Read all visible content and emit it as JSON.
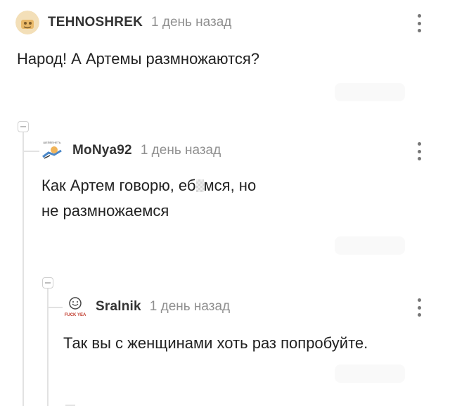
{
  "comments": [
    {
      "username": "TEHNOSHREK",
      "timestamp": "1 день назад",
      "text": "Народ! А Артемы размножаются?"
    },
    {
      "username": "MoNya92",
      "timestamp": "1 день назад",
      "text_before_censor": "Как Артем говорю, еб",
      "text_after_censor": "мся, но",
      "text_line2": "не размножаемся"
    },
    {
      "username": "Sralnik",
      "timestamp": "1 день назад",
      "text": "Так вы с женщинами хоть раз попробуйте."
    }
  ],
  "icons": {
    "collapse": "minus-square-icon",
    "menu": "more-vertical-icon"
  },
  "colors": {
    "text": "#222222",
    "username": "#333333",
    "timestamp": "#8f8f8f",
    "thread_line": "#e2e2e2"
  }
}
